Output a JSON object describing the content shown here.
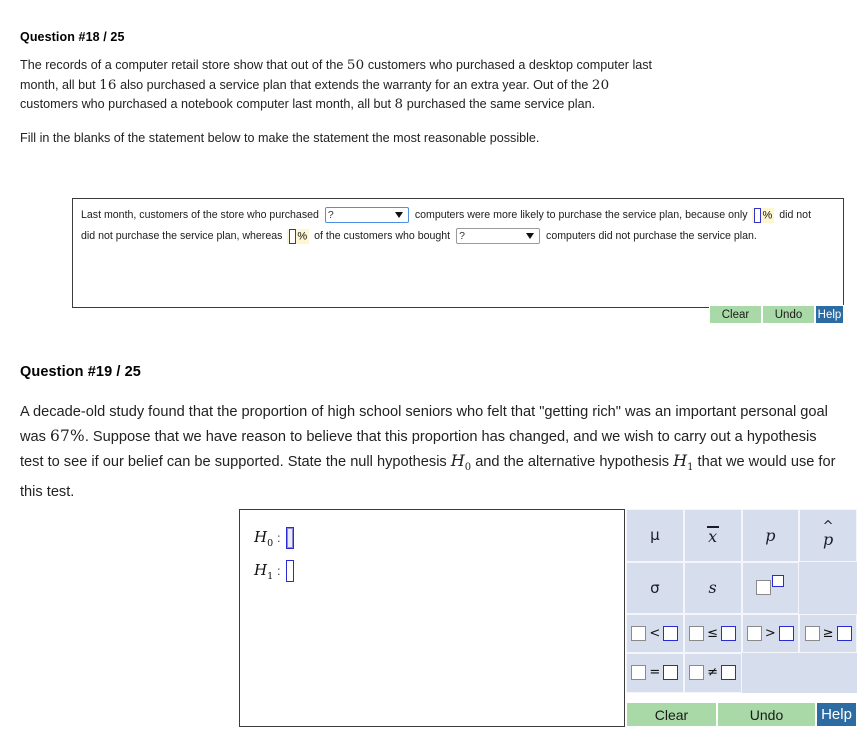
{
  "question18": {
    "heading": "Question #18 / 25",
    "body": {
      "s1": "The records of a computer retail store show that out of the",
      "n1": "50",
      "s2": "customers who purchased a desktop computer last month, all but",
      "n2": "16",
      "s3": "also purchased a service plan that extends the warranty for an extra year. Out of the",
      "n3": "20",
      "s4": "customers who purchased a notebook computer last month, all but",
      "n4": "8",
      "s5": "purchased the same service plan."
    },
    "instruction": "Fill in the blanks of the statement below to make the statement the most reasonable possible.",
    "fill_in": {
      "t1": "Last month, customers of the store who purchased",
      "select1_value": "?",
      "t2": "computers were more likely to purchase the service plan, because only",
      "pct1_value": "",
      "pct_sign": "%",
      "t3": "did not purchase the service plan, whereas",
      "pct2_value": "",
      "t4": "of the customers who bought",
      "select2_value": "?",
      "t5": "computers did not purchase the service plan."
    },
    "buttons": {
      "clear": "Clear",
      "undo": "Undo",
      "help": "Help"
    }
  },
  "question19": {
    "heading": "Question #19 / 25",
    "body": {
      "s1": "A decade-old study found that the proportion of high school seniors who felt that \"getting rich\" was an important personal goal was",
      "n1": "67%",
      "s2": ". Suppose that we have reason to believe that this proportion has changed, and we wish to carry out a hypothesis test to see if our belief can be supported. State the null hypothesis",
      "var1": "H",
      "var1_sub": "0",
      "s3": "and the alternative hypothesis",
      "var2": "H",
      "var2_sub": "1",
      "s4": "that we would use for this test."
    },
    "answer": {
      "rows": [
        {
          "label": "H",
          "sub": "0",
          "colon": ":",
          "value": "",
          "focused": true
        },
        {
          "label": "H",
          "sub": "1",
          "colon": ":",
          "value": "",
          "focused": false
        }
      ]
    },
    "keypad": {
      "rows": [
        [
          {
            "name": "mu",
            "glyph": "μ",
            "kind": "upright"
          },
          {
            "name": "x-bar",
            "glyph": "x",
            "kind": "overbar"
          },
          {
            "name": "p",
            "glyph": "p",
            "kind": "italic"
          },
          {
            "name": "p-hat",
            "glyph": "p",
            "kind": "overhat"
          }
        ],
        [
          {
            "name": "sigma",
            "glyph": "σ",
            "kind": "upright"
          },
          {
            "name": "s",
            "glyph": "s",
            "kind": "italic"
          },
          {
            "name": "box-superscript-box",
            "glyph": "",
            "kind": "power"
          },
          {
            "name": "blank",
            "glyph": "",
            "kind": "empty"
          }
        ],
        [
          {
            "name": "less-than",
            "glyph": "<",
            "kind": "relation"
          },
          {
            "name": "less-than-or-equal",
            "glyph": "≤",
            "kind": "relation"
          },
          {
            "name": "greater-than",
            "glyph": ">",
            "kind": "relation"
          },
          {
            "name": "greater-than-or-equal",
            "glyph": "≥",
            "kind": "relation"
          }
        ],
        [
          {
            "name": "equals",
            "glyph": "=",
            "kind": "relation"
          },
          {
            "name": "not-equal",
            "glyph": "≠",
            "kind": "relation"
          },
          {
            "name": "blank",
            "glyph": "",
            "kind": "empty"
          },
          {
            "name": "blank",
            "glyph": "",
            "kind": "empty"
          }
        ]
      ]
    },
    "buttons": {
      "clear": "Clear",
      "undo": "Undo",
      "help": "Help"
    }
  },
  "colors": {
    "button_green": "#a8d9a7",
    "button_blue": "#2d6ca2",
    "keypad_bg": "#d6dded",
    "input_border_focus": "#2b2bd4",
    "highlight_yellow": "#fdf6d3"
  }
}
